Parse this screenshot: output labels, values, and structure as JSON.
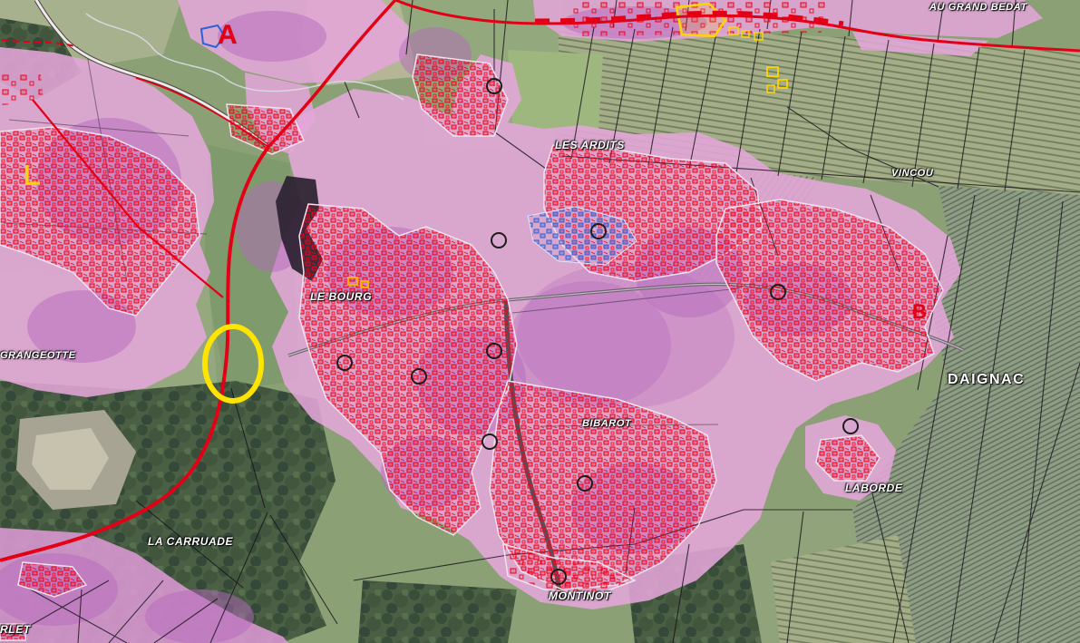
{
  "map": {
    "commune_label": "DAIGNAC",
    "place_labels": [
      {
        "id": "au-grand-bedat",
        "text": "AU GRAND BEDAT"
      },
      {
        "id": "les-ardits",
        "text": "LES ARDITS"
      },
      {
        "id": "vincou",
        "text": "VINCOU"
      },
      {
        "id": "le-bourg",
        "text": "LE BOURG"
      },
      {
        "id": "grangeotte",
        "text": "GRANGEOTTE"
      },
      {
        "id": "bibarot",
        "text": "BIBAROT"
      },
      {
        "id": "laborde",
        "text": "LABORDE"
      },
      {
        "id": "la-carruade",
        "text": "LA CARRUADE"
      },
      {
        "id": "montinot",
        "text": "MONTINOT"
      },
      {
        "id": "rlet",
        "text": "RLET"
      }
    ],
    "zone_letters": {
      "a": "A",
      "b": "B"
    },
    "annotation": {
      "highlight_color": "#ffe400"
    },
    "colors": {
      "zone_pink": "#e4a6da",
      "zone_purple": "#b569bd",
      "building_red": "#f20018",
      "building_blue": "#2a62d8",
      "road_red": "#e30016",
      "protected_yellow": "#ffd400"
    }
  }
}
